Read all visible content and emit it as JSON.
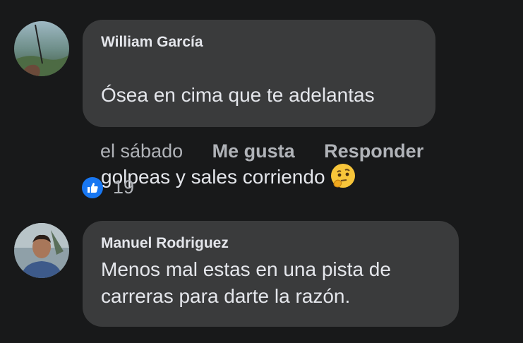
{
  "comments": [
    {
      "author": "William García",
      "text_line1": "Ósea en cima que te adelantas",
      "text_line2": "golpeas y sales corriendo",
      "emoji": "thinking-face",
      "time": "el sábado",
      "like_label": "Me gusta",
      "reply_label": "Responder",
      "reaction_icon": "like-icon",
      "reaction_count": "19"
    },
    {
      "author": "Manuel Rodriguez",
      "text": "Menos mal estas en una pista de\ncarreras para darte la razón."
    }
  ],
  "colors": {
    "background": "#18191a",
    "bubble": "#3a3b3c",
    "text": "#e4e6eb",
    "muted": "#b0b3b8",
    "like_blue": "#1877f2"
  }
}
